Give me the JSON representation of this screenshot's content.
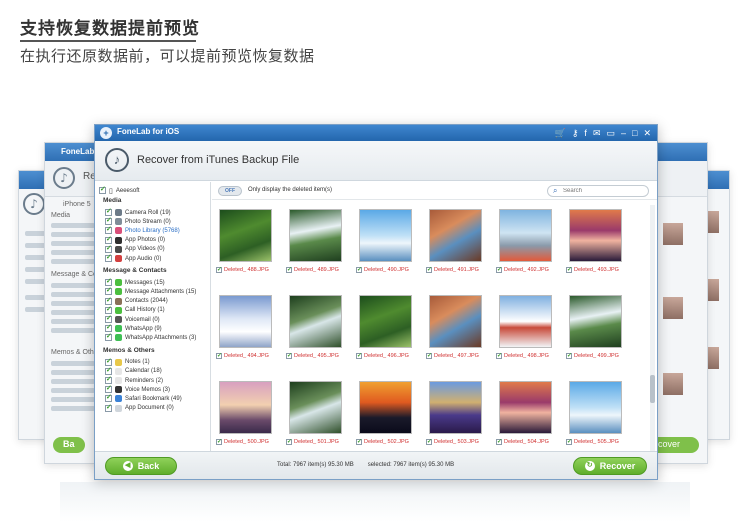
{
  "heading": "支持恢复数据提前预览",
  "subheading": "在执行还原数据前，可以提前预览恢复数据",
  "ghost_left": {
    "title": "FoneLab",
    "header_partial": "Re",
    "device": "iPhone 5",
    "sections": [
      "Media",
      "Message & Conta",
      "Memos & Other"
    ],
    "back_partial": "Ba"
  },
  "ghost_right": {
    "recover_partial": "ecover"
  },
  "window": {
    "title": "FoneLab for iOS",
    "header_title": "Recover from iTunes Backup File",
    "device": "Aeeesoft",
    "toggle_state": "OFF",
    "toggle_label": "Only display the deleted item(s)",
    "search_placeholder": "Search",
    "title_icons": [
      "cart-icon",
      "key-icon",
      "facebook-icon",
      "chat-icon",
      "screen-icon",
      "minimize-icon",
      "maximize-icon",
      "close-icon"
    ]
  },
  "sidebar": {
    "sections": [
      {
        "title": "Media",
        "items": [
          {
            "label": "Camera Roll (19)",
            "color": "#6c7a88"
          },
          {
            "label": "Photo Stream (0)",
            "color": "#7f8c98"
          },
          {
            "label": "Photo Library (5768)",
            "color": "#d94f7a",
            "active": true
          },
          {
            "label": "App Photos (0)",
            "color": "#2f2f2f"
          },
          {
            "label": "App Videos (0)",
            "color": "#4a4a4a"
          },
          {
            "label": "App Audio (0)",
            "color": "#d24040"
          }
        ]
      },
      {
        "title": "Message & Contacts",
        "items": [
          {
            "label": "Messages (15)",
            "color": "#4cbf3f"
          },
          {
            "label": "Message Attachments (15)",
            "color": "#4cbf3f"
          },
          {
            "label": "Contacts (2044)",
            "color": "#8a7058"
          },
          {
            "label": "Call History (1)",
            "color": "#4cbf3f"
          },
          {
            "label": "Voicemail (0)",
            "color": "#555555"
          },
          {
            "label": "WhatsApp (9)",
            "color": "#3fbf55"
          },
          {
            "label": "WhatsApp Attachments (3)",
            "color": "#3fbf55"
          }
        ]
      },
      {
        "title": "Memos & Others",
        "items": [
          {
            "label": "Notes (1)",
            "color": "#e8c84a"
          },
          {
            "label": "Calendar (18)",
            "color": "#e6e6e6"
          },
          {
            "label": "Reminders (2)",
            "color": "#e6e6e6"
          },
          {
            "label": "Voice Memos (3)",
            "color": "#333333"
          },
          {
            "label": "Safari Bookmark (49)",
            "color": "#3b82d6"
          },
          {
            "label": "App Document (0)",
            "color": "#d0d6dc"
          }
        ]
      }
    ]
  },
  "photos": [
    {
      "label": "Deleted_ 488.JPG",
      "theme": "forest"
    },
    {
      "label": "Deleted_ 489.JPG",
      "theme": "waterfall"
    },
    {
      "label": "Deleted_ 490.JPG",
      "theme": "sky"
    },
    {
      "label": "Deleted_ 491.JPG",
      "theme": "canyon"
    },
    {
      "label": "Deleted_ 492.JPG",
      "theme": "balloon"
    },
    {
      "label": "Deleted_ 493.JPG",
      "theme": "sunset"
    },
    {
      "label": "Deleted_ 494.JPG",
      "theme": "snow"
    },
    {
      "label": "Deleted_ 495.JPG",
      "theme": "stream"
    },
    {
      "label": "Deleted_ 496.JPG",
      "theme": "forest"
    },
    {
      "label": "Deleted_ 497.JPG",
      "theme": "canyon"
    },
    {
      "label": "Deleted_ 498.JPG",
      "theme": "winter"
    },
    {
      "label": "Deleted_ 499.JPG",
      "theme": "waterfall"
    },
    {
      "label": "Deleted_ 500.JPG",
      "theme": "tower"
    },
    {
      "label": "Deleted_ 501.JPG",
      "theme": "stream"
    },
    {
      "label": "Deleted_ 502.JPG",
      "theme": "palm"
    },
    {
      "label": "Deleted_ 503.JPG",
      "theme": "temple"
    },
    {
      "label": "Deleted_ 504.JPG",
      "theme": "sunset"
    },
    {
      "label": "Deleted_ 505.JPG",
      "theme": "sky"
    }
  ],
  "footer": {
    "back_label": "Back",
    "total": "Total: 7967 item(s) 95.30 MB",
    "selected": "selected: 7967 item(s) 95.30 MB",
    "recover_label": "Recover"
  }
}
